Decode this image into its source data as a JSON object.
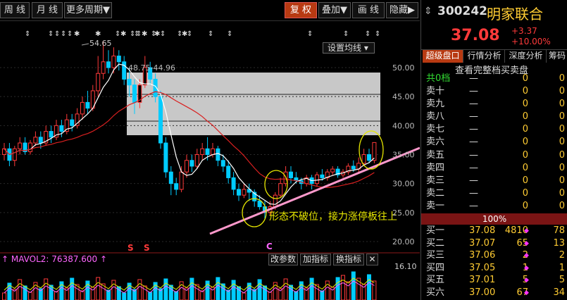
{
  "toolbar": {
    "left_buttons": [
      "周 线",
      "月 线",
      "更多周期▼"
    ],
    "right_buttons": [
      "复 权",
      "叠加▼",
      "画 线",
      "隐藏▶"
    ],
    "active_right": "复 权"
  },
  "chart": {
    "ma_setting": "设置均线 ▾",
    "price_axis": [
      "50.00",
      "45.00",
      "40.00",
      "35.00",
      "30.00",
      "25.00",
      "20.00"
    ],
    "annot_high": "54.65",
    "annot_range": "48.75-44.96",
    "annotation_text": "形态不破位，接力涨停板往上",
    "signals": [
      "S",
      "S",
      "C"
    ],
    "sub_label": "MAVOL2: 76387.600",
    "sub_buttons": [
      "改参数",
      "加指标",
      "换指标",
      "✕"
    ],
    "sub_axis": "16.10",
    "colors": {
      "up": "#ff3a3a",
      "down": "#00ccff",
      "ma_white": "#ffffff",
      "ma_red": "#d92020",
      "trend": "#ff99cc",
      "circle": "#e6e600"
    }
  },
  "panel": {
    "code": "300242",
    "name": "明家联合",
    "price": "37.08",
    "change": "+3.37",
    "change_pct": "+10.00%",
    "tabs": [
      "超级盘口",
      "行情分析",
      "深度分析",
      "筹码"
    ],
    "active_tab": "超级盘口",
    "book_link": "查看完整档买卖盘",
    "total_label": "共0档",
    "sell": [
      {
        "label": "卖十",
        "price": "—",
        "vol": "0",
        "chg": "0"
      },
      {
        "label": "卖九",
        "price": "—",
        "vol": "0",
        "chg": "0"
      },
      {
        "label": "卖八",
        "price": "—",
        "vol": "0",
        "chg": "0"
      },
      {
        "label": "卖七",
        "price": "—",
        "vol": "0",
        "chg": "0"
      },
      {
        "label": "卖六",
        "price": "—",
        "vol": "0",
        "chg": "0"
      },
      {
        "label": "卖五",
        "price": "—",
        "vol": "0",
        "chg": "0"
      },
      {
        "label": "卖四",
        "price": "—",
        "vol": "0",
        "chg": "0"
      },
      {
        "label": "卖三",
        "price": "—",
        "vol": "0",
        "chg": "0"
      },
      {
        "label": "卖二",
        "price": "—",
        "vol": "0",
        "chg": "0"
      },
      {
        "label": "卖一",
        "price": "—",
        "vol": "0",
        "chg": "0"
      }
    ],
    "total_row": {
      "price": "—",
      "vol": "0",
      "chg": "0"
    },
    "ratio": "100%",
    "buy": [
      {
        "label": "买一",
        "price": "37.08",
        "vol": "4810",
        "chg": "78"
      },
      {
        "label": "买二",
        "price": "37.07",
        "vol": "65",
        "chg": "13"
      },
      {
        "label": "买三",
        "price": "37.06",
        "vol": "2",
        "chg": "2"
      },
      {
        "label": "买四",
        "price": "37.05",
        "vol": "1",
        "chg": "1"
      },
      {
        "label": "买五",
        "price": "37.01",
        "vol": "5",
        "chg": "5"
      },
      {
        "label": "买六",
        "price": "37.00",
        "vol": "67",
        "chg": "34"
      }
    ]
  }
}
